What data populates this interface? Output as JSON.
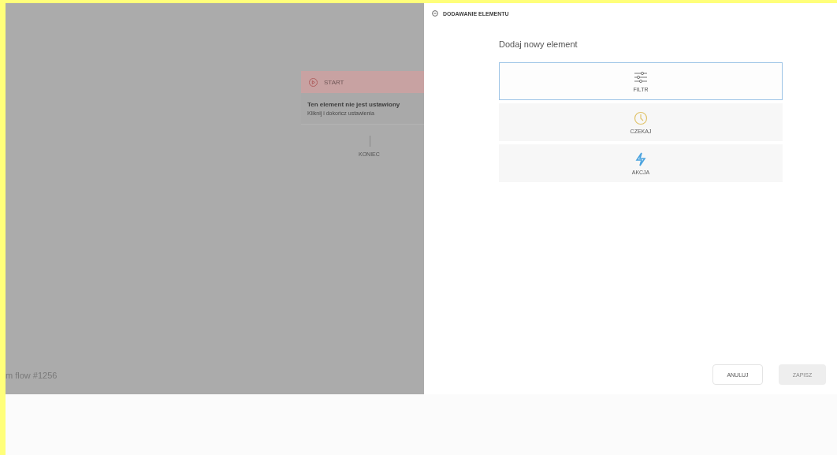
{
  "canvas": {
    "start_node": {
      "label": "START",
      "title": "Ten element nie jest ustawiony",
      "hint": "Kliknij i dokończ ustawienia"
    },
    "end_node": {
      "label": "KONIEC"
    },
    "flow_name": "m flow #1256"
  },
  "panel": {
    "header": "DODAWANIE ELEMENTU",
    "heading": "Dodaj nowy element",
    "options": [
      {
        "kind": "filter",
        "label": "FILTR",
        "selected": true
      },
      {
        "kind": "wait",
        "label": "CZEKAJ",
        "selected": false
      },
      {
        "kind": "action",
        "label": "AKCJA",
        "selected": false
      }
    ],
    "buttons": [
      {
        "label": "ANULUJ",
        "disabled": false
      },
      {
        "label": "ZAPISZ",
        "disabled": true
      }
    ]
  }
}
